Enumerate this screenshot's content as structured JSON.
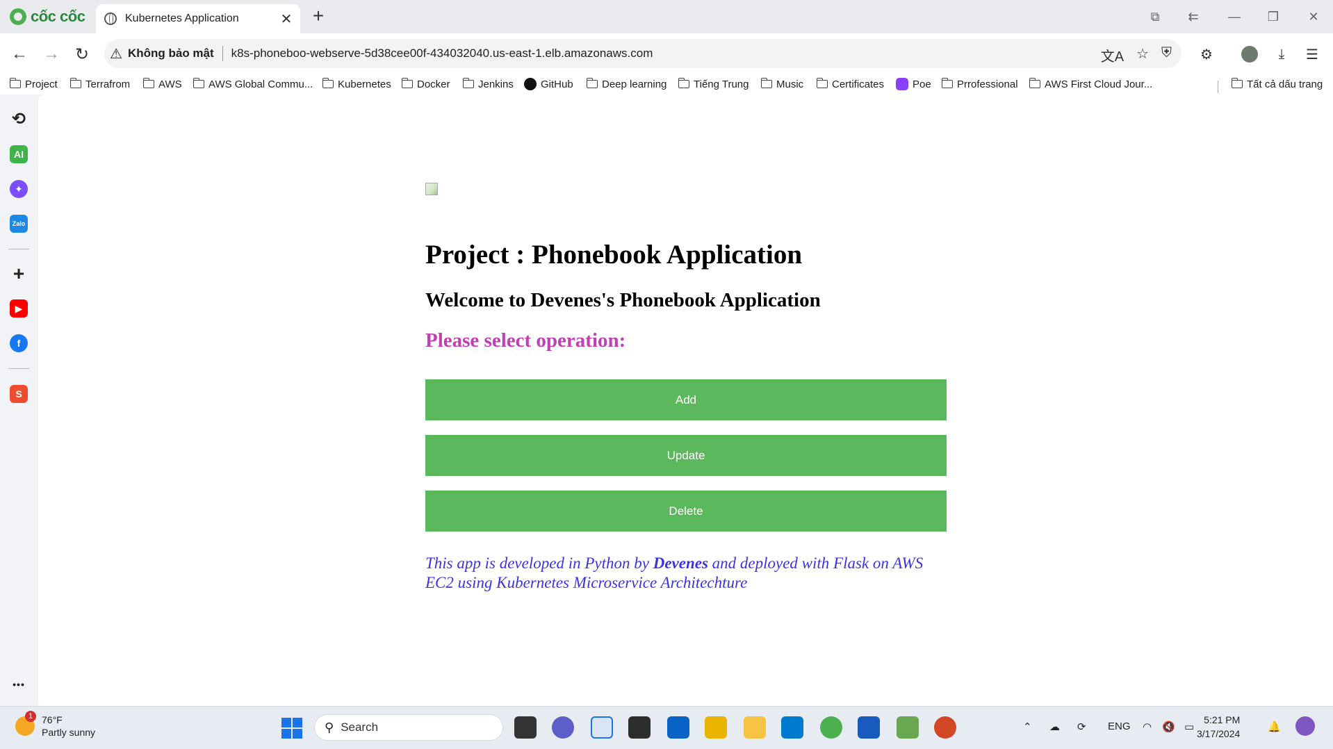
{
  "browser": {
    "brand": "cốc cốc",
    "tab_title": "Kubernetes Application",
    "security_label": "Không bảo mật",
    "url": "k8s-phoneboo-webserve-5d38cee00f-434032040.us-east-1.elb.amazonaws.com",
    "bookmarks": [
      {
        "label": "Project",
        "icon": "folder-icon"
      },
      {
        "label": "Terrafrom",
        "icon": "folder-icon"
      },
      {
        "label": "AWS",
        "icon": "folder-icon"
      },
      {
        "label": "AWS Global Commu...",
        "icon": "folder-icon"
      },
      {
        "label": "Kubernetes",
        "icon": "folder-icon"
      },
      {
        "label": "Docker",
        "icon": "folder-icon"
      },
      {
        "label": "Jenkins",
        "icon": "folder-icon"
      },
      {
        "label": "GitHub",
        "icon": "github-icon"
      },
      {
        "label": "Deep learning",
        "icon": "folder-icon"
      },
      {
        "label": "Tiếng Trung",
        "icon": "folder-icon"
      },
      {
        "label": "Music",
        "icon": "folder-icon"
      },
      {
        "label": "Certificates",
        "icon": "folder-icon"
      },
      {
        "label": "Poe",
        "icon": "poe-icon"
      },
      {
        "label": "Prrofessional",
        "icon": "folder-icon"
      },
      {
        "label": "AWS First Cloud Jour...",
        "icon": "folder-icon"
      }
    ],
    "all_bookmarks_label": "Tất cả dấu trang",
    "sidebar_ai_label": "AI",
    "sidebar_zalo_label": "Zalo",
    "sidebar_more": "•••"
  },
  "page": {
    "title": "Project : Phonebook Application",
    "welcome": "Welcome to Devenes's Phonebook Application",
    "prompt": "Please select operation:",
    "buttons": {
      "add": "Add",
      "update": "Update",
      "delete": "Delete"
    },
    "footer": {
      "before": "This app is developed in Python by ",
      "author": "Devenes",
      "after": " and deployed with Flask on AWS EC2 using Kubernetes Microservice Architechture"
    },
    "colors": {
      "button_bg": "#5cb85c",
      "prompt_color": "#c03fb1",
      "footer_color": "#3b33e0"
    }
  },
  "taskbar": {
    "temperature": "76°F",
    "condition": "Partly sunny",
    "weather_badge": "1",
    "search_placeholder": "Search",
    "language": "ENG",
    "time": "5:21 PM",
    "date": "3/17/2024"
  }
}
